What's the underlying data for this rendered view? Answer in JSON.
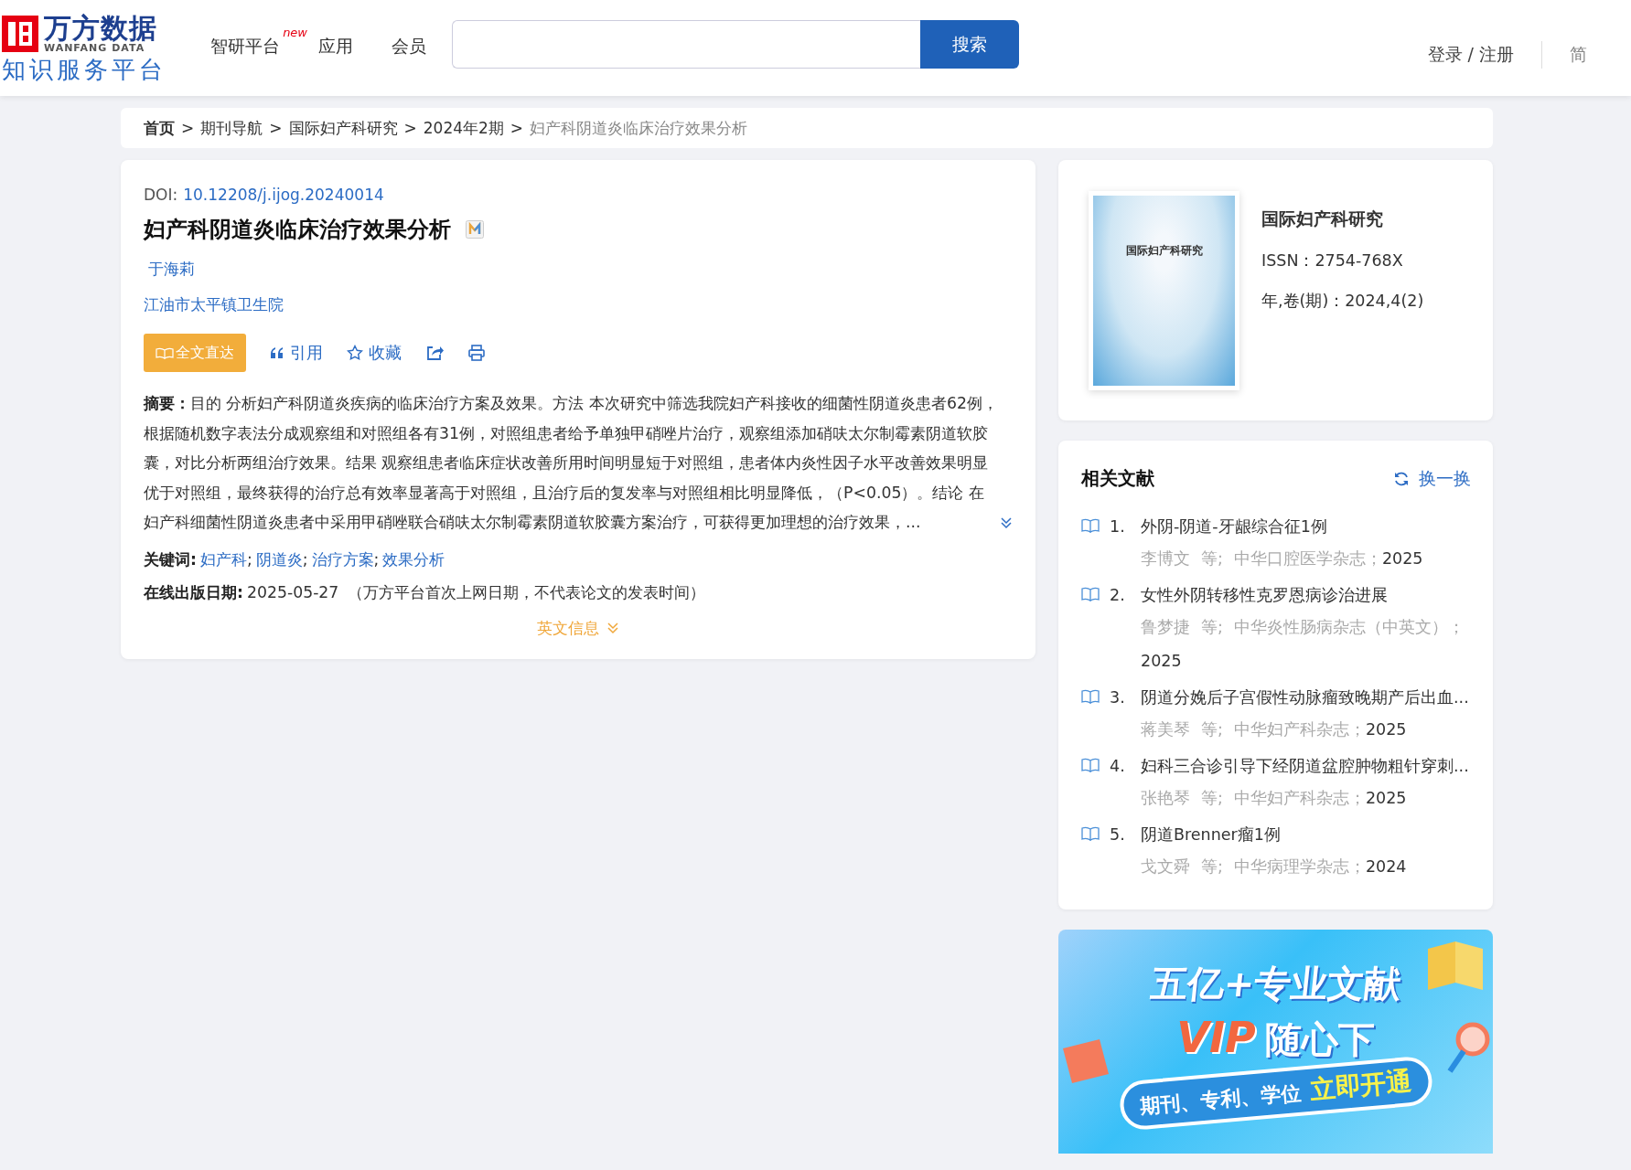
{
  "header": {
    "logo": {
      "brand": "万方数据",
      "brand_en": "WANFANG DATA",
      "tagline": "知识服务平台"
    },
    "nav": [
      {
        "label": "智研平台",
        "badge": "new"
      },
      {
        "label": "应用"
      },
      {
        "label": "会员"
      }
    ],
    "search": {
      "button": "搜索"
    },
    "login": "登录 / 注册",
    "lang": "简"
  },
  "breadcrumb": [
    {
      "label": "首页",
      "kind": "home"
    },
    {
      "label": "期刊导航",
      "kind": "link"
    },
    {
      "label": "国际妇产科研究",
      "kind": "link"
    },
    {
      "label": "2024年2期",
      "kind": "link"
    },
    {
      "label": "妇产科阴道炎临床治疗效果分析",
      "kind": "current"
    }
  ],
  "breadcrumb_separator": ">",
  "article": {
    "doi_label": "DOI:",
    "doi": "10.12208/j.ijog.20240014",
    "title": "妇产科阴道炎临床治疗效果分析",
    "author": "于海莉",
    "affiliation": "江油市太平镇卫生院",
    "actions": [
      {
        "kind": "fulltext",
        "label": "全文直达"
      },
      {
        "kind": "cite",
        "label": "引用"
      },
      {
        "kind": "favorite",
        "label": "收藏"
      },
      {
        "kind": "share"
      },
      {
        "kind": "print"
      }
    ],
    "abstract": "**摘要：**目的 分析妇产科阴道炎疾病的临床治疗方案及效果。方法 本次研究中筛选我院妇产科接收的细菌性阴道炎患者62例，根据随机数字表法分成观察组和对照组各有31例，对照组患者给予单独甲硝唑片治疗，观察组添加硝呋太尔制霉素阴道软胶囊，对比分析两组治疗效果。结果 观察组患者临床症状改善所用时间明显短于对照组，患者体内炎性因子水平改善效果明显优于对照组，最终获得的治疗总有效率显著高于对照组，且治疗后的复发率与对照组相比明显降低，（P<0.05）。结论 在妇产科细菌性阴道炎患者中采用甲硝唑联合硝呋太尔制霉素阴道软胶囊方案治疗，可获得更加理想的治疗效果，...",
    "keywords_label": "关键词:",
    "keywords_separator": ";",
    "keywords": [
      "妇产科",
      "阴道炎",
      "治疗方案",
      "效果分析"
    ],
    "date_label": "在线出版日期:",
    "date": "2025-05-27",
    "date_note": "（万方平台首次上网日期，不代表论文的发表时间）",
    "english_toggle": "英文信息"
  },
  "journal": {
    "cover_title": "国际妇产科研究",
    "name": "国际妇产科研究",
    "issn": "ISSN：2754-768X",
    "issue": "年,卷(期)：2024,4(2)"
  },
  "related": {
    "title": "相关文献",
    "refresh": "换一换",
    "items": [
      {
        "number": "1.",
        "title": "外阴-阴道-牙龈综合征1例",
        "authors": "李博文",
        "etal": "等;",
        "journal": "中华口腔医学杂志；",
        "year": "2025"
      },
      {
        "number": "2.",
        "title": "女性外阴转移性克罗恩病诊治进展",
        "authors": "鲁梦捷",
        "etal": "等;",
        "journal": "中华炎性肠病杂志（中英文）；",
        "year": "2025"
      },
      {
        "number": "3.",
        "title": "阴道分娩后子宫假性动脉瘤致晚期产后出血...",
        "authors": "蒋美琴",
        "etal": "等;",
        "journal": "中华妇产科杂志；",
        "year": "2025"
      },
      {
        "number": "4.",
        "title": "妇科三合诊引导下经阴道盆腔肿物粗针穿刺...",
        "authors": "张艳琴",
        "etal": "等;",
        "journal": "中华妇产科杂志；",
        "year": "2025"
      },
      {
        "number": "5.",
        "title": "阴道Brenner瘤1例",
        "authors": "戈文舜",
        "etal": "等;",
        "journal": "中华病理学杂志；",
        "year": "2024"
      }
    ]
  },
  "banner": {
    "headline": "五亿+专业文献",
    "vip": "VIP",
    "vip_tail": "随心下",
    "pill": "期刊、专利、学位",
    "cta": "立即开通"
  }
}
